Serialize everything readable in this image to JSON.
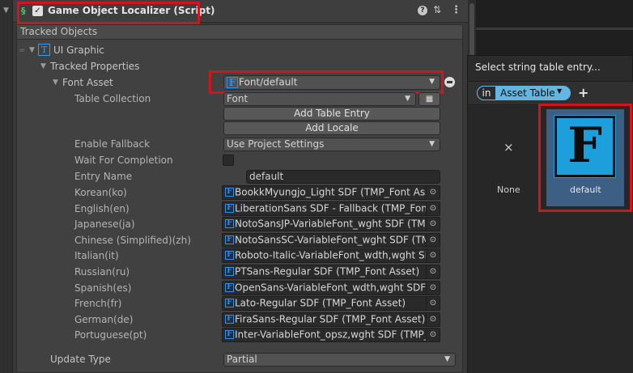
{
  "component": {
    "title": "Game Object Localizer (Script)",
    "help_icon": "?",
    "preset_icon": "sliders-icon",
    "menu_icon": "⋮"
  },
  "tracked_objects": {
    "label": "Tracked Objects",
    "object_name": "UI Graphic",
    "properties_label": "Tracked Properties",
    "font_asset": {
      "label": "Font Asset",
      "value": "Font/default",
      "table_collection_label": "Table Collection",
      "table_collection_value": "Font",
      "add_table_entry": "Add Table Entry",
      "add_locale": "Add Locale",
      "enable_fallback_label": "Enable Fallback",
      "enable_fallback_value": "Use Project Settings",
      "wait_label": "Wait For Completion",
      "entry_name_label": "Entry Name",
      "entry_name_value": "default",
      "locales": [
        {
          "label": "Korean(ko)",
          "value": "BookkMyungjo_Light SDF (TMP_Font Asse"
        },
        {
          "label": "English(en)",
          "value": "LiberationSans SDF - Fallback (TMP_Font"
        },
        {
          "label": "Japanese(ja)",
          "value": "NotoSansJP-VariableFont_wght SDF (TMF"
        },
        {
          "label": "Chinese (Simplified)(zh)",
          "value": "NotoSansSC-VariableFont_wght SDF (TMI"
        },
        {
          "label": "Italian(it)",
          "value": "Roboto-Italic-VariableFont_wdth,wght SDI"
        },
        {
          "label": "Russian(ru)",
          "value": "PTSans-Regular SDF (TMP_Font Asset)"
        },
        {
          "label": "Spanish(es)",
          "value": "OpenSans-VariableFont_wdth,wght SDF ("
        },
        {
          "label": "French(fr)",
          "value": "Lato-Regular SDF (TMP_Font Asset)"
        },
        {
          "label": "German(de)",
          "value": "FiraSans-Regular SDF (TMP_Font Asset)"
        },
        {
          "label": "Portuguese(pt)",
          "value": "Inter-VariableFont_opsz,wght SDF (TMP_F"
        }
      ]
    },
    "update_type_label": "Update Type",
    "update_type_value": "Partial"
  },
  "popup": {
    "title": "Select string table entry...",
    "filter_prefix": "in",
    "filter_value": "Asset Table",
    "add_icon": "+",
    "items": [
      {
        "label": "None",
        "icon": "×"
      },
      {
        "label": "default",
        "icon": "F"
      }
    ]
  },
  "colors": {
    "highlight": "#d0161c",
    "accent": "#1d9fdc"
  }
}
